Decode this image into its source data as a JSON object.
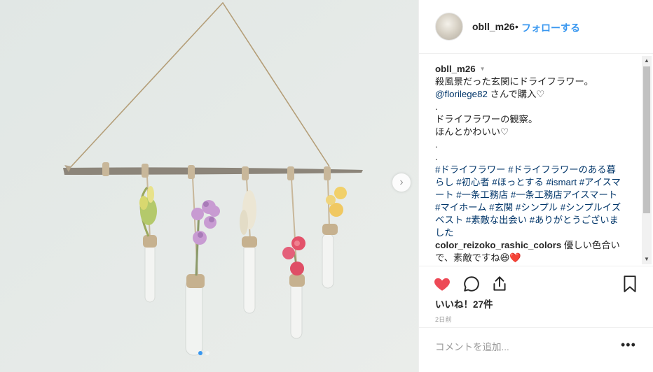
{
  "header": {
    "username": "obll_m26",
    "separator": "•",
    "follow_label": "フォローする"
  },
  "caption": {
    "username": "obll_m26",
    "line1": "殺風景だった玄関にドライフラワー。",
    "mention": "@florilege82",
    "mention_suffix": " さんで購入♡",
    "dot1": ".",
    "line2": "ドライフラワーの観察。",
    "line3": "ほんとかわいい♡",
    "dot2": ".",
    "dot3": ".",
    "hashtags": "#ドライフラワー #ドライフラワーのある暮らし #初心者 #ほっとする #ismart #アイスマート #一条工務店 #一条工務店アイスマート #マイホーム #玄関 #シンプル #シンプルイズベスト #素敵な出会い #ありがとうございました"
  },
  "comment": {
    "username": "color_reizoko_rashic_colors",
    "text": " 優しい色合いで、素敵ですね😆❤️"
  },
  "likes_label": "いいね！27件",
  "time_label": "2日前",
  "add_comment_placeholder": "コメントを追加...",
  "more_label": "•••",
  "icons": {
    "like": "heart-icon",
    "comment": "comment-icon",
    "share": "share-icon",
    "save": "bookmark-icon",
    "next": "chevron-right-icon"
  },
  "colors": {
    "like": "#ed4956",
    "link": "#003569",
    "follow": "#3897f0"
  },
  "carousel": {
    "count": 2,
    "active": 1
  }
}
